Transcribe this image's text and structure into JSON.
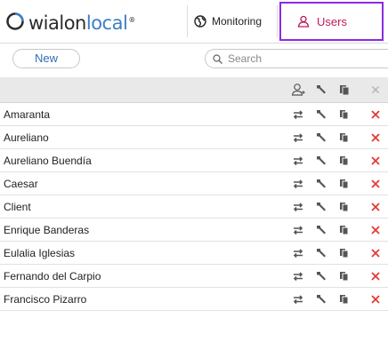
{
  "brand": {
    "name_main": "wialon",
    "name_local": "local",
    "sup": "®"
  },
  "nav": {
    "monitoring_label": "Monitoring",
    "users_label": "Users",
    "accent": "#8a2be2",
    "users_color": "#c2185b"
  },
  "toolbar": {
    "new_label": "New",
    "search_placeholder": "Search",
    "search_value": ""
  },
  "grid": {
    "header_icons": [
      "user-login-icon",
      "wrench-icon",
      "copy-icon",
      "delete-icon"
    ],
    "row_icons": [
      "switch-icon",
      "wrench-icon",
      "copy-icon",
      "delete-icon"
    ],
    "delete_color": "#e53935",
    "users": [
      "Amaranta",
      "Aureliano",
      "Aureliano Buendía",
      "Caesar",
      "Client",
      "Enrique Banderas",
      "Eulalia Iglesias",
      "Fernando del Carpio",
      "Francisco Pizarro"
    ]
  }
}
